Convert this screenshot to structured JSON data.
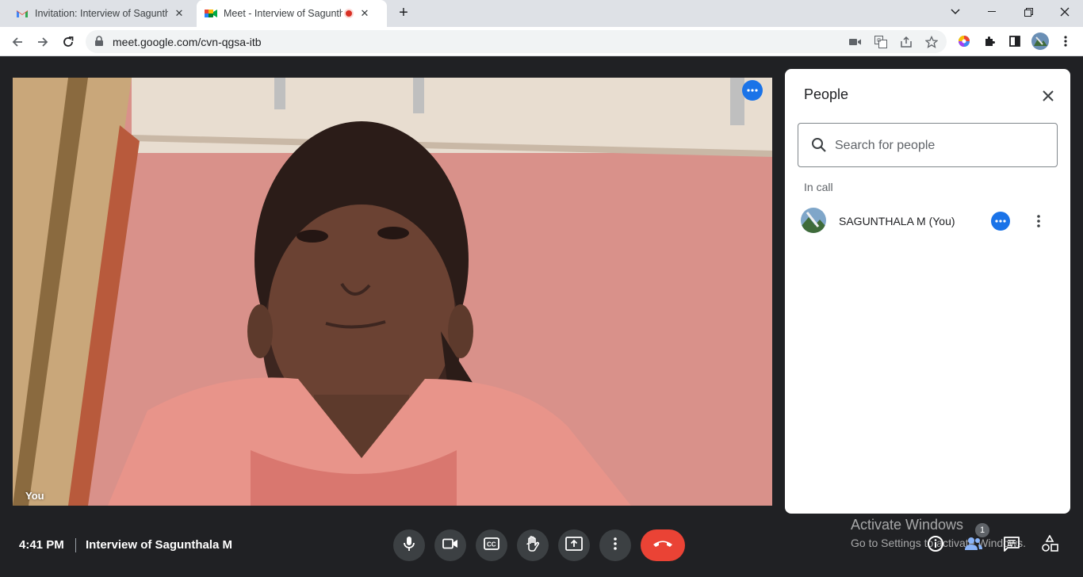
{
  "browser": {
    "tabs": [
      {
        "title": "Invitation: Interview of Sagunthal",
        "icon": "gmail-icon"
      },
      {
        "title": "Meet - Interview of Sagunthala",
        "icon": "meet-icon",
        "recording": true
      }
    ],
    "url": "meet.google.com/cvn-qgsa-itb"
  },
  "video": {
    "self_label": "You"
  },
  "people_panel": {
    "title": "People",
    "search_placeholder": "Search for people",
    "section_label": "In call",
    "participants": [
      {
        "name": "SAGUNTHALA M (You)"
      }
    ]
  },
  "bottom_bar": {
    "time": "4:41 PM",
    "meeting_title": "Interview of Sagunthala M",
    "participant_count": "1"
  },
  "watermark": {
    "title": "Activate Windows",
    "subtitle": "Go to Settings to activate Windows."
  },
  "colors": {
    "accent": "#1a73e8",
    "hangup": "#ea4335",
    "background": "#202124"
  }
}
